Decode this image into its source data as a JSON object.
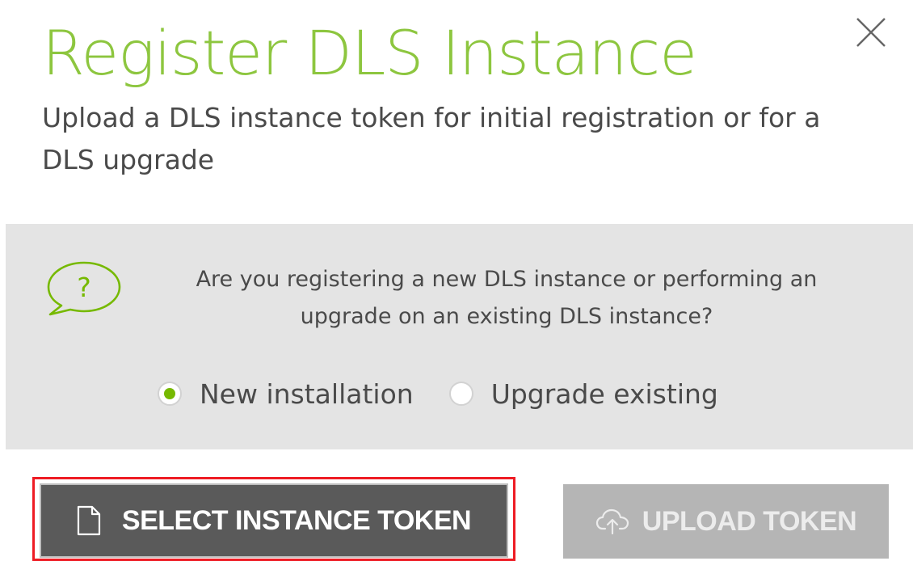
{
  "dialog": {
    "title": "Register DLS Instance",
    "subtitle": "Upload a DLS instance token for initial registration or for a DLS upgrade",
    "close_icon": "close-icon",
    "accent_color": "#8dc63f"
  },
  "panel": {
    "icon": "question-bubble-icon",
    "question": "Are you registering a new DLS instance or performing an upgrade on an existing DLS instance?",
    "options": [
      {
        "label": "New installation",
        "selected": true
      },
      {
        "label": "Upgrade existing",
        "selected": false
      }
    ]
  },
  "actions": {
    "select_token": {
      "label": "SELECT INSTANCE TOKEN",
      "icon": "file-icon",
      "highlighted": true,
      "highlight_color": "#ee1c24"
    },
    "upload_token": {
      "label": "UPLOAD TOKEN",
      "icon": "cloud-upload-icon",
      "disabled": true
    }
  }
}
